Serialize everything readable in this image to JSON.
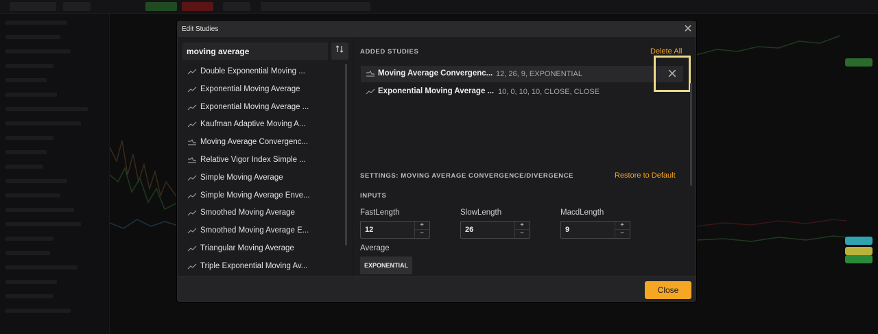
{
  "dialog": {
    "title": "Edit Studies",
    "close_symbol": "×"
  },
  "search": {
    "value": "moving average",
    "filter_icon": "sort-icon"
  },
  "study_list": [
    {
      "label": "Double Exponential Moving ...",
      "icon": "line-study-icon"
    },
    {
      "label": "Exponential Moving Average",
      "icon": "line-study-icon"
    },
    {
      "label": "Exponential Moving Average ...",
      "icon": "line-study-icon"
    },
    {
      "label": "Kaufman Adaptive Moving A...",
      "icon": "line-study-icon"
    },
    {
      "label": "Moving Average Convergenc...",
      "icon": "lower-study-icon"
    },
    {
      "label": "Relative Vigor Index Simple ...",
      "icon": "lower-study-icon"
    },
    {
      "label": "Simple Moving Average",
      "icon": "line-study-icon"
    },
    {
      "label": "Simple Moving Average Enve...",
      "icon": "line-study-icon"
    },
    {
      "label": "Smoothed Moving Average",
      "icon": "line-study-icon"
    },
    {
      "label": "Smoothed Moving Average E...",
      "icon": "line-study-icon"
    },
    {
      "label": "Triangular Moving Average",
      "icon": "line-study-icon"
    },
    {
      "label": "Triple Exponential Moving Av...",
      "icon": "line-study-icon"
    }
  ],
  "added": {
    "title": "ADDED STUDIES",
    "delete_all": "Delete All",
    "remove_symbol": "×",
    "items": [
      {
        "name": "Moving Average Convergenc...",
        "params": "12, 26, 9, EXPONENTIAL",
        "icon": "lower-study-icon"
      },
      {
        "name": "Exponential Moving Average ...",
        "params": "10, 0, 10, 10, CLOSE, CLOSE",
        "icon": "line-study-icon"
      }
    ]
  },
  "settings": {
    "title": "SETTINGS: MOVING AVERAGE CONVERGENCE/DIVERGENCE",
    "restore": "Restore to Default",
    "inputs_title": "INPUTS",
    "fields": [
      {
        "label": "FastLength",
        "value": "12"
      },
      {
        "label": "SlowLength",
        "value": "26"
      },
      {
        "label": "MacdLength",
        "value": "9"
      }
    ],
    "stepper_up": "+",
    "stepper_down": "−",
    "average_label": "Average",
    "average_value": "EXPONENTIAL"
  },
  "footer": {
    "close_label": "Close"
  },
  "colors": {
    "accent": "#f5a623",
    "highlight_border": "#ead98a",
    "dialog_bg": "#1c1c1e"
  }
}
